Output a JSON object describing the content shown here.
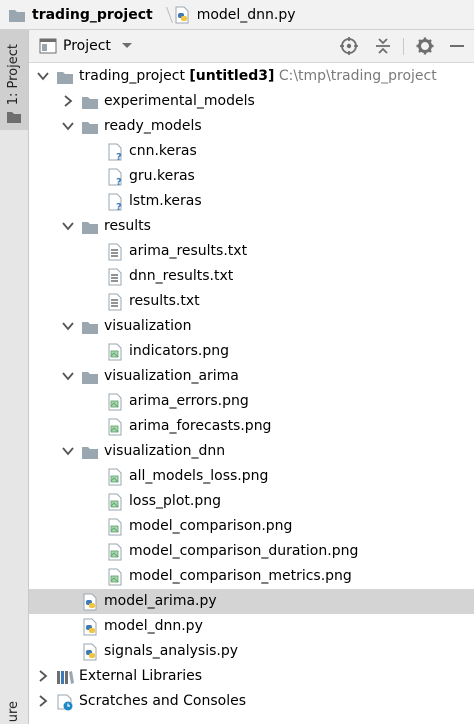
{
  "breadcrumb": {
    "project": "trading_project",
    "file": "model_dnn.py"
  },
  "stripe": {
    "project_tab": "1: Project",
    "structure_tab": "ure"
  },
  "panel": {
    "view_label": "Project"
  },
  "icons": {
    "folder": "folder-icon",
    "module_folder": "module-folder-icon",
    "keras_file": "unknown-file-icon",
    "text_file": "text-file-icon",
    "image_file": "image-file-icon",
    "python_file": "python-file-icon",
    "libraries": "external-libraries-icon",
    "scratches": "scratches-icon"
  },
  "tree": {
    "root": {
      "name": "trading_project",
      "module": "[untitled3]",
      "path": "C:\\tmp\\trading_project",
      "expanded": true
    },
    "items": [
      {
        "label": "experimental_models",
        "kind": "folder",
        "expanded": false
      },
      {
        "label": "ready_models",
        "kind": "folder",
        "expanded": true
      },
      {
        "label": "cnn.keras",
        "kind": "keras"
      },
      {
        "label": "gru.keras",
        "kind": "keras"
      },
      {
        "label": "lstm.keras",
        "kind": "keras"
      },
      {
        "label": "results",
        "kind": "folder",
        "expanded": true
      },
      {
        "label": "arima_results.txt",
        "kind": "text"
      },
      {
        "label": "dnn_results.txt",
        "kind": "text"
      },
      {
        "label": "results.txt",
        "kind": "text"
      },
      {
        "label": "visualization",
        "kind": "folder",
        "expanded": true
      },
      {
        "label": "indicators.png",
        "kind": "image"
      },
      {
        "label": "visualization_arima",
        "kind": "folder",
        "expanded": true
      },
      {
        "label": "arima_errors.png",
        "kind": "image"
      },
      {
        "label": "arima_forecasts.png",
        "kind": "image"
      },
      {
        "label": "visualization_dnn",
        "kind": "folder",
        "expanded": true
      },
      {
        "label": "all_models_loss.png",
        "kind": "image"
      },
      {
        "label": "loss_plot.png",
        "kind": "image"
      },
      {
        "label": "model_comparison.png",
        "kind": "image"
      },
      {
        "label": "model_comparison_duration.png",
        "kind": "image"
      },
      {
        "label": "model_comparison_metrics.png",
        "kind": "image"
      },
      {
        "label": "model_arima.py",
        "kind": "python",
        "selected": true
      },
      {
        "label": "model_dnn.py",
        "kind": "python"
      },
      {
        "label": "signals_analysis.py",
        "kind": "python"
      },
      {
        "label": "External Libraries",
        "kind": "libraries",
        "expanded": false
      },
      {
        "label": "Scratches and Consoles",
        "kind": "scratches",
        "expanded": false
      }
    ]
  },
  "colors": {
    "selection": "#d4d4d4",
    "folder": "#9aa7b0",
    "python_blue": "#3d7ab8",
    "python_yellow": "#f4c540"
  }
}
